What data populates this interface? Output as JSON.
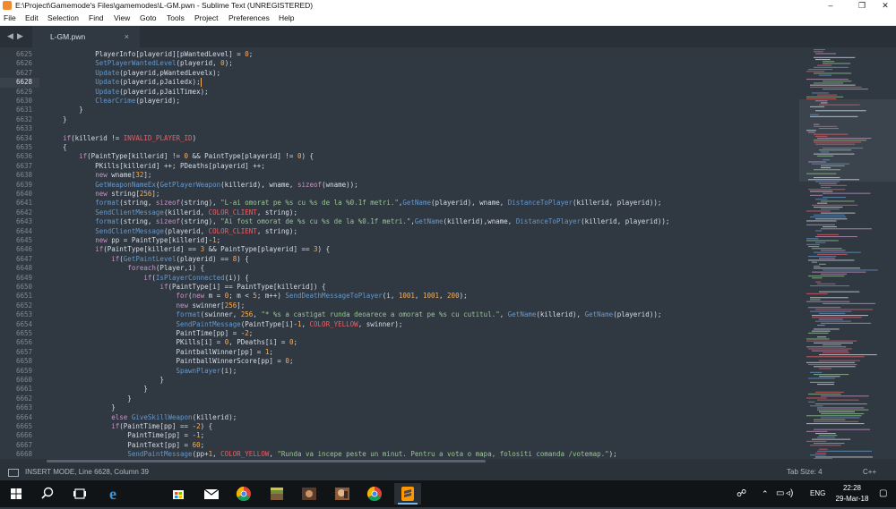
{
  "window": {
    "title": "E:\\Project\\Gamemode's Files\\gamemodes\\L-GM.pwn - Sublime Text (UNREGISTERED)",
    "controls": [
      "–",
      "❐",
      "✕"
    ]
  },
  "menu": [
    "File",
    "Edit",
    "Selection",
    "Find",
    "View",
    "Goto",
    "Tools",
    "Project",
    "Preferences",
    "Help"
  ],
  "tab_nav": [
    "◀",
    "▶"
  ],
  "tab": {
    "label": "L-GM.pwn",
    "close": "×"
  },
  "editor": {
    "current_line": 6628,
    "line_numbers": [
      "6625",
      "6626",
      "6627",
      "6628",
      "6629",
      "6630",
      "6631",
      "6632",
      "6633",
      "6634",
      "6635",
      "6636",
      "6637",
      "6638",
      "6639",
      "6640",
      "6641",
      "6642",
      "6643",
      "6644",
      "6645",
      "6646",
      "6647",
      "6648",
      "6649",
      "6650",
      "6651",
      "6652",
      "6653",
      "6654",
      "6655",
      "6656",
      "6657",
      "6658",
      "6659",
      "6660",
      "6661",
      "6662",
      "6663",
      "6664",
      "6665",
      "6666",
      "6667",
      "6668"
    ],
    "lines": [
      "            PlayerInfo[playerid][pWantedLevel] = 0;",
      "            SetPlayerWantedLevel(playerid, 0);",
      "            Update(playerid,pWantedLevelx);",
      "            Update(playerid,pJailedx);",
      "            Update(playerid,pJailTimex);",
      "            ClearCrime(playerid);",
      "        }",
      "    }",
      "",
      "    if(killerid != INVALID_PLAYER_ID)",
      "    {",
      "        if(PaintType[killerid] != 0 && PaintType[playerid] != 0) {",
      "            PKills[killerid] ++; PDeaths[playerid] ++;",
      "            new wname[32];",
      "            GetWeaponNameEx(GetPlayerWeapon(killerid), wname, sizeof(wname));",
      "            new string[256];",
      "            format(string, sizeof(string), \"L-ai omorat pe %s cu %s de la %0.1f metri.\",GetName(playerid), wname, DistanceToPlayer(killerid, playerid));",
      "            SendClientMessage(killerid, COLOR_CLIENT, string);",
      "            format(string, sizeof(string), \"Ai fost omorat de %s cu %s de la %0.1f metri.\",GetName(killerid),wname, DistanceToPlayer(killerid, playerid));",
      "            SendClientMessage(playerid, COLOR_CLIENT, string);",
      "            new pp = PaintType[killerid]-1;",
      "            if(PaintType[killerid] == 3 && PaintType[playerid] == 3) {",
      "                if(GetPaintLevel(playerid) == 8) {",
      "                    foreach(Player,i) {",
      "                        if(IsPlayerConnected(i)) {",
      "                            if(PaintType[i] == PaintType[killerid]) {",
      "                                for(new m = 0; m < 5; m++) SendDeathMessageToPlayer(i, 1001, 1001, 200);",
      "                                new swinner[256];",
      "                                format(swinner, 256, \"* %s a castigat runda deoarece a omorat pe %s cu cutitul.\", GetName(killerid), GetName(playerid));",
      "                                SendPaintMessage(PaintType[i]-1, COLOR_YELLOW, swinner);",
      "                                PaintTime[pp] = -2;",
      "                                PKills[i] = 0, PDeaths[i] = 0;",
      "                                PaintballWinner[pp] = 1;",
      "                                PaintballWinnerScore[pp] = 0;",
      "                                SpawnPlayer(i);",
      "                            }",
      "                        }",
      "                    }",
      "                }",
      "                else GiveSkillWeapon(killerid);",
      "                if(PaintTime[pp] == -2) {",
      "                    PaintTime[pp] = -1;",
      "                    PaintText[pp] = 60;",
      "                    SendPaintMessage(pp+1, COLOR_YELLOW, \"Runda va incepe peste un minut. Pentru a vota o mapa, folositi comanda /votemap.\");"
    ]
  },
  "status": {
    "left": "INSERT MODE, Line 6628, Column 39",
    "tab_size": "Tab Size: 4",
    "syntax": "C++"
  },
  "taskbar": {
    "items": [
      "windows-start",
      "search",
      "task-view",
      "edge",
      "store",
      "mail",
      "chrome",
      "minecraft",
      "game-a",
      "game-b",
      "chrome-2",
      "sublime-text"
    ],
    "language": "ENG",
    "time": "22:28",
    "date": "29-Mar-18"
  },
  "colors": {
    "editor_bg": "#303841",
    "keyword": "#c695c6",
    "string": "#99c794",
    "number": "#f9ae58",
    "constant": "#ec5f66",
    "function": "#6699cc",
    "text": "#d8dee9"
  }
}
